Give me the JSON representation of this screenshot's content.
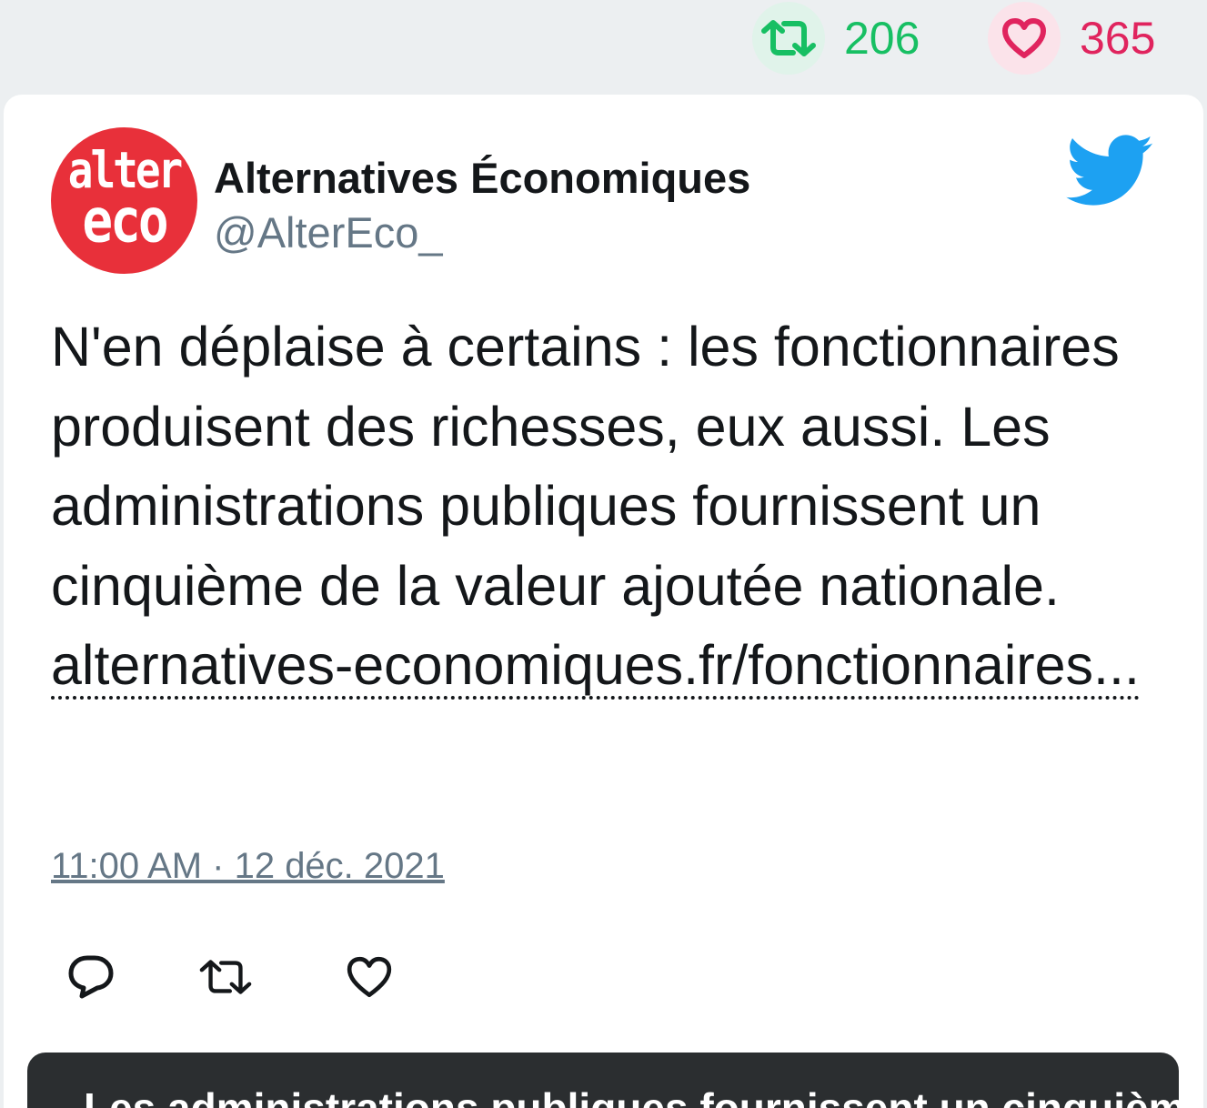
{
  "previous_tweet": {
    "retweet_count": "206",
    "like_count": "365",
    "retweet_color": "#17bf63",
    "like_color": "#e0245e"
  },
  "tweet": {
    "avatar": {
      "line1": "alter",
      "line2": "eco",
      "background": "#e8303a"
    },
    "display_name": "Alternatives Économiques",
    "handle": "@AlterEco_",
    "brand_icon": "twitter-bird-icon",
    "brand_color": "#1da1f2",
    "text": "N'en déplaise à certains : les fonctionnaires produisent des richesses, eux aussi. Les administrations publiques fournissent un cinquième de la valeur ajoutée nationale. ",
    "link_text": "alternatives-economiques.fr/fonctionnaires...",
    "timestamp": "11:00 AM · 12 déc. 2021",
    "actions": [
      {
        "name": "reply",
        "icon": "reply-icon"
      },
      {
        "name": "retweet",
        "icon": "retweet-icon"
      },
      {
        "name": "like",
        "icon": "heart-icon"
      }
    ],
    "link_preview": {
      "title": "Les administrations publiques fournissent un cinquième"
    }
  }
}
